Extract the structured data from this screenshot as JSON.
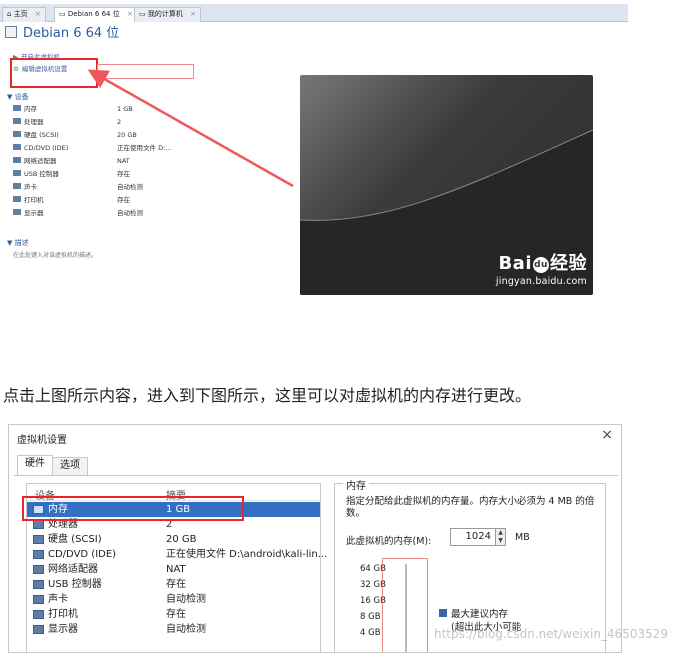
{
  "top_screenshot": {
    "tabs": [
      {
        "label": "主页",
        "close": "×"
      },
      {
        "label": "Debian 6 64 位",
        "close": "×"
      },
      {
        "label": "我的计算机",
        "close": "×"
      }
    ],
    "vm_title": "Debian 6 64 位",
    "actions": [
      {
        "label": "开启此虚拟机"
      },
      {
        "label": "编辑虚拟机设置"
      }
    ],
    "devices_section": "▼ 设备",
    "devices": [
      {
        "name": "内存",
        "summary": "1 GB"
      },
      {
        "name": "处理器",
        "summary": "2"
      },
      {
        "name": "硬盘 (SCSI)",
        "summary": "20 GB"
      },
      {
        "name": "CD/DVD (IDE)",
        "summary": "正在使用文件 D:..."
      },
      {
        "name": "网络适配器",
        "summary": "NAT"
      },
      {
        "name": "USB 控制器",
        "summary": "存在"
      },
      {
        "name": "声卡",
        "summary": "自动检测"
      },
      {
        "name": "打印机",
        "summary": "存在"
      },
      {
        "name": "显示器",
        "summary": "自动检测"
      }
    ],
    "description_section": "▼ 描述",
    "description_text": "在此处键入对该虚拟机的描述。",
    "watermark_logo": "Bai",
    "watermark_paw": "du",
    "watermark_word": "经验",
    "watermark_site": "jingyan.baidu.com"
  },
  "caption": "点击上图所示内容，进入到下图所示，这里可以对虚拟机的内存进行更改。",
  "dialog": {
    "title": "虚拟机设置",
    "close": "×",
    "tabs": [
      "硬件",
      "选项"
    ],
    "list_headers": {
      "device": "设备",
      "summary": "摘要"
    },
    "devices": [
      {
        "name": "内存",
        "summary": "1 GB",
        "selected": true
      },
      {
        "name": "处理器",
        "summary": "2"
      },
      {
        "name": "硬盘 (SCSI)",
        "summary": "20 GB"
      },
      {
        "name": "CD/DVD (IDE)",
        "summary": "正在使用文件 D:\\android\\kali-lin..."
      },
      {
        "name": "网络适配器",
        "summary": "NAT"
      },
      {
        "name": "USB 控制器",
        "summary": "存在"
      },
      {
        "name": "声卡",
        "summary": "自动检测"
      },
      {
        "name": "打印机",
        "summary": "存在"
      },
      {
        "name": "显示器",
        "summary": "自动检测"
      }
    ],
    "memory": {
      "group_label": "内存",
      "description": "指定分配给此虚拟机的内存量。内存大小必须为 4 MB 的倍数。",
      "field_label": "此虚拟机的内存(M):",
      "value": "1024",
      "unit": "MB",
      "scale_ticks": [
        "64 GB",
        "32 GB",
        "16 GB",
        "8 GB",
        "4 GB"
      ],
      "recommended_label": "最大建议内存",
      "recommended_note": "(超出此大小可能"
    }
  },
  "page_watermark": "https://blog.csdn.net/weixin_46503529",
  "colors": {
    "annotation_red": "#e8272d",
    "selection_blue": "#3370c3",
    "link_blue": "#2d5c9e"
  }
}
